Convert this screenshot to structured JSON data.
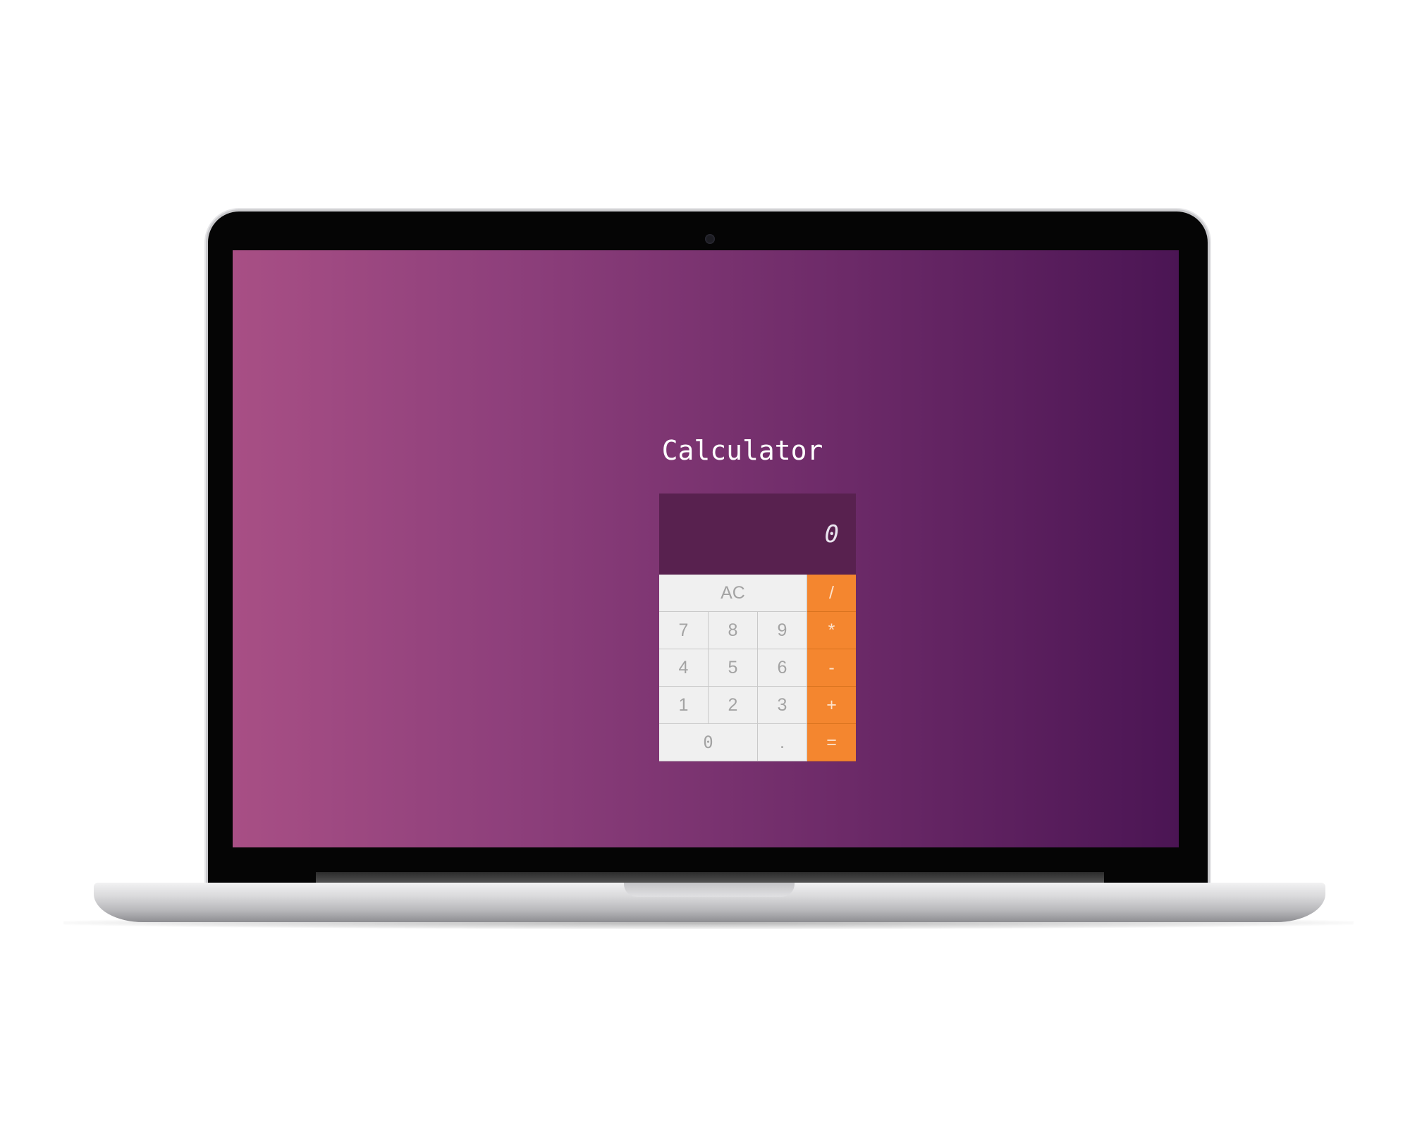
{
  "colors": {
    "screen_gradient_start": "#a84f85",
    "screen_gradient_end": "#4b1554",
    "display_bg": "#58214f",
    "key_bg": "#f0f0f0",
    "operator_bg": "#f4862f"
  },
  "app": {
    "title": "Calculator",
    "display_value": "0"
  },
  "keys": {
    "clear": "AC",
    "divide": "/",
    "seven": "7",
    "eight": "8",
    "nine": "9",
    "multiply": "*",
    "four": "4",
    "five": "5",
    "six": "6",
    "subtract": "-",
    "one": "1",
    "two": "2",
    "three": "3",
    "add": "+",
    "zero": "0",
    "decimal": ".",
    "equals": "="
  }
}
